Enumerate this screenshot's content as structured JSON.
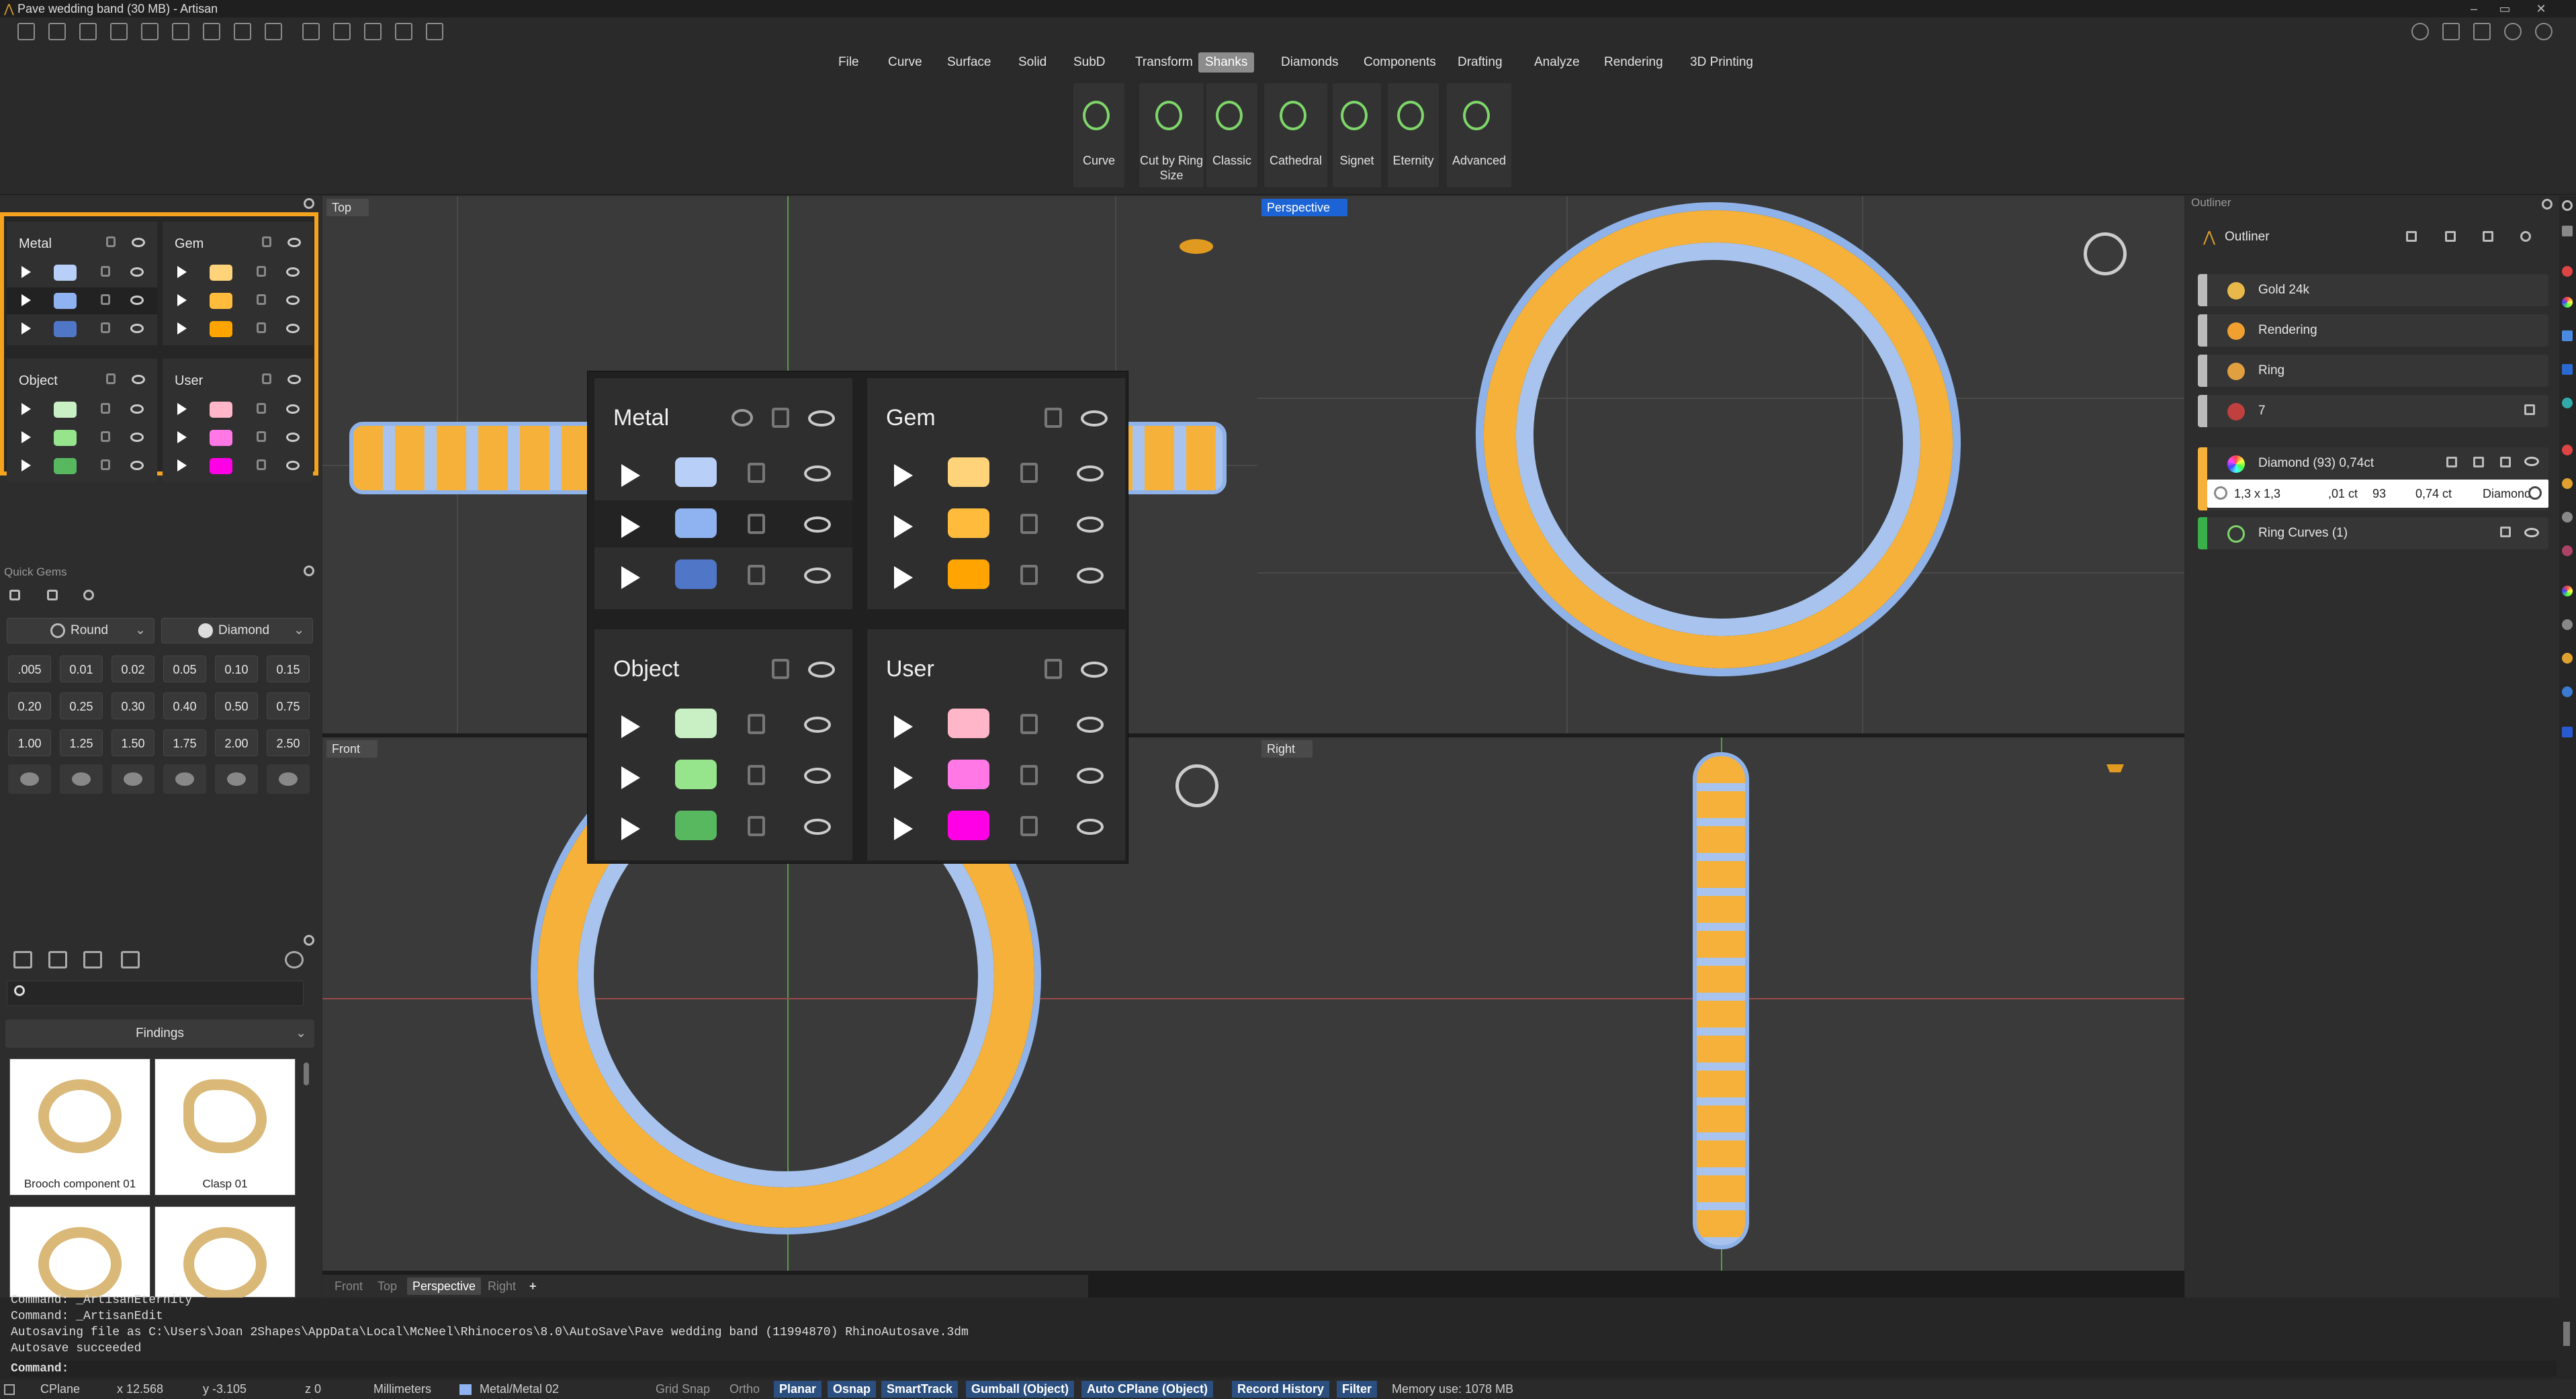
{
  "app": {
    "title": "Pave wedding band (30 MB) - Artisan"
  },
  "menu": {
    "items": [
      "File",
      "Curve",
      "Surface",
      "Solid",
      "SubD",
      "Transform",
      "Shanks",
      "Diamonds",
      "Components",
      "Drafting",
      "Analyze",
      "Rendering",
      "3D Printing"
    ],
    "active": "Shanks"
  },
  "ribbon": {
    "buttons": [
      {
        "label": "Curve",
        "icon": "curve-shank-icon"
      },
      {
        "label": "Cut by Ring Size",
        "icon": "cut-by-ring-size-icon"
      },
      {
        "label": "Classic",
        "icon": "classic-shank-icon"
      },
      {
        "label": "Cathedral",
        "icon": "cathedral-shank-icon"
      },
      {
        "label": "Signet",
        "icon": "signet-shank-icon"
      },
      {
        "label": "Eternity",
        "icon": "eternity-shank-icon"
      },
      {
        "label": "Advanced",
        "icon": "advanced-shank-icon"
      }
    ]
  },
  "layers": {
    "metal": {
      "title": "Metal",
      "colors": [
        "#b8d0f8",
        "#8fb2f0",
        "#5076c8"
      ],
      "highlighted_row": 1
    },
    "gem": {
      "title": "Gem",
      "colors": [
        "#ffd37a",
        "#ffbc3c",
        "#ffa400"
      ]
    },
    "object": {
      "title": "Object",
      "colors": [
        "#c8f0c4",
        "#96e48c",
        "#58b860"
      ]
    },
    "user": {
      "title": "User",
      "colors": [
        "#ffb6c8",
        "#ff78e6",
        "#ff00e6"
      ]
    }
  },
  "quick_gems": {
    "title": "Quick Gems",
    "shape": "Round",
    "material": "Diamond",
    "sizes": [
      ".005",
      "0.01",
      "0.02",
      "0.05",
      "0.10",
      "0.15",
      "0.20",
      "0.25",
      "0.30",
      "0.40",
      "0.50",
      "0.75",
      "1.00",
      "1.25",
      "1.50",
      "1.75",
      "2.00",
      "2.50"
    ]
  },
  "library": {
    "category": "Findings",
    "items": [
      {
        "caption": "Brooch component 01"
      },
      {
        "caption": "Clasp 01"
      },
      {
        "caption": ""
      },
      {
        "caption": ""
      }
    ]
  },
  "viewports": {
    "top": "Top",
    "perspective": "Perspective",
    "front": "Front",
    "right": "Right",
    "tabs": [
      "Front",
      "Top",
      "Perspective",
      "Right"
    ],
    "active_tab": "Perspective"
  },
  "outliner": {
    "title": "Outliner",
    "header": "Outliner",
    "rows": [
      {
        "label": "Gold 24k",
        "icon": "gold-material-icon",
        "color": "#e8b84a"
      },
      {
        "label": "Rendering",
        "icon": "palette-icon",
        "color": "#f0a030"
      },
      {
        "label": "Ring",
        "icon": "ring-icon",
        "color": "#e0a040"
      },
      {
        "label": "7",
        "icon": "us-flag-icon",
        "color": "#c04040"
      }
    ],
    "gem_row": {
      "label": "Diamond (93) 0,74ct",
      "size": "1,3 x 1,3",
      "ct_each": ",01 ct",
      "count": "93",
      "ct_total": "0,74 ct",
      "material": "Diamond"
    },
    "curves_row": {
      "label": "Ring Curves (1)"
    }
  },
  "command": {
    "history": [
      "Command: _ArtisanEternity",
      "Command: _ArtisanEdit",
      "Autosaving file as C:\\Users\\Joan 2Shapes\\AppData\\Local\\McNeel\\Rhinoceros\\8.0\\AutoSave\\Pave wedding band (11994870) RhinoAutosave.3dm",
      "Autosave succeeded"
    ],
    "prompt": "Command:"
  },
  "status": {
    "cplane": "CPlane",
    "x": "x 12.568",
    "y": "y -3.105",
    "z": "z 0",
    "units": "Millimeters",
    "layer": "Metal/Metal 02",
    "grid_snap": "Grid Snap",
    "ortho": "Ortho",
    "planar": "Planar",
    "osnap": "Osnap",
    "smarttrack": "SmartTrack",
    "gumball": "Gumball (Object)",
    "auto_cplane": "Auto CPlane (Object)",
    "record_history": "Record History",
    "filter": "Filter",
    "memory": "Memory use: 1078 MB"
  }
}
